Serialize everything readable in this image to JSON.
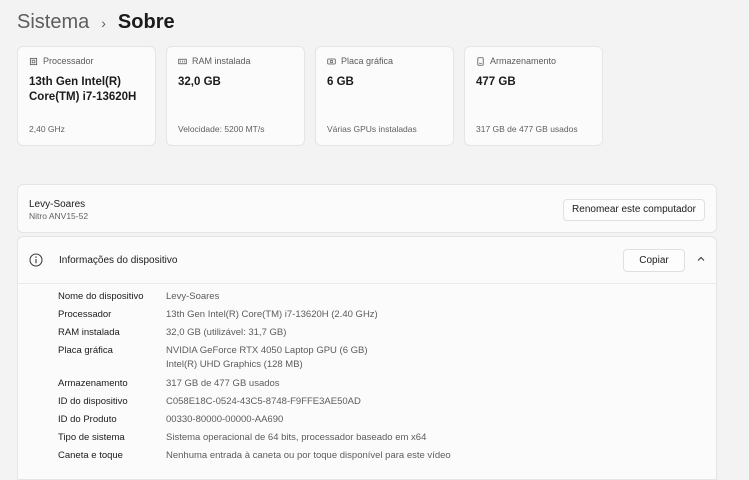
{
  "breadcrumb": {
    "parent": "Sistema",
    "separator": "›",
    "current": "Sobre"
  },
  "cards": [
    {
      "icon": "processor-icon",
      "label": "Processador",
      "value": "13th Gen Intel(R) Core(TM) i7-13620H",
      "sub": "2,40 GHz"
    },
    {
      "icon": "ram-icon",
      "label": "RAM instalada",
      "value": "32,0 GB",
      "sub": "Velocidade: 5200 MT/s"
    },
    {
      "icon": "gpu-icon",
      "label": "Placa gráfica",
      "value": "6 GB",
      "sub": "Várias GPUs instaladas"
    },
    {
      "icon": "storage-icon",
      "label": "Armazenamento",
      "value": "477 GB",
      "sub": "317 GB de 477 GB usados"
    }
  ],
  "device": {
    "name": "Levy-Soares",
    "model": "Nitro ANV15-52",
    "rename_label": "Renomear este computador"
  },
  "info": {
    "title": "Informações do dispositivo",
    "copy_label": "Copiar",
    "specs": [
      {
        "label": "Nome do dispositivo",
        "value": "Levy-Soares"
      },
      {
        "label": "Processador",
        "value": "13th Gen Intel(R) Core(TM) i7-13620H (2.40 GHz)"
      },
      {
        "label": "RAM instalada",
        "value": "32,0 GB (utilizável: 31,7 GB)"
      },
      {
        "label": "Placa gráfica",
        "value": "NVIDIA GeForce RTX 4050 Laptop GPU (6 GB)",
        "value2": "Intel(R) UHD Graphics (128 MB)"
      },
      {
        "label": "Armazenamento",
        "value": "317 GB de 477 GB usados"
      },
      {
        "label": "ID do dispositivo",
        "value": "C058E18C-0524-43C5-8748-F9FFE3AE50AD"
      },
      {
        "label": "ID do Produto",
        "value": "00330-80000-00000-AA690"
      },
      {
        "label": "Tipo de sistema",
        "value": "Sistema operacional de 64 bits, processador baseado em x64"
      },
      {
        "label": "Caneta e toque",
        "value": "Nenhuma entrada à caneta ou por toque disponível para este vídeo"
      }
    ]
  }
}
